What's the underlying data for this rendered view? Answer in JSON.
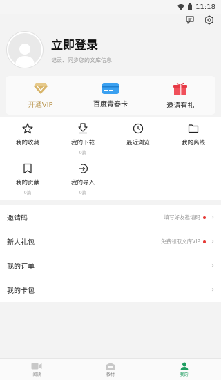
{
  "status_bar": {
    "time": "11:18"
  },
  "profile": {
    "title": "立即登录",
    "subtitle": "记录、同步您的文库信息"
  },
  "cards": [
    {
      "label": "开通VIP",
      "icon": "diamond-icon"
    },
    {
      "label": "百度青春卡",
      "icon": "card-icon"
    },
    {
      "label": "邀请有礼",
      "icon": "gift-icon"
    }
  ],
  "grid": [
    {
      "label": "我的收藏",
      "count": "",
      "icon": "star-icon"
    },
    {
      "label": "我的下载",
      "count": "0篇",
      "icon": "download-icon"
    },
    {
      "label": "最近浏览",
      "count": "",
      "icon": "clock-icon"
    },
    {
      "label": "我的离线",
      "count": "",
      "icon": "folder-icon"
    },
    {
      "label": "我的贡献",
      "count": "0篇",
      "icon": "bookmark-icon"
    },
    {
      "label": "我的导入",
      "count": "0篇",
      "icon": "import-icon"
    }
  ],
  "list": [
    {
      "label": "邀请码",
      "hint": "填写好友邀请码"
    },
    {
      "label": "新人礼包",
      "hint": "免费领取文库VIP"
    },
    {
      "label": "我的订单",
      "hint": ""
    },
    {
      "label": "我的卡包",
      "hint": ""
    }
  ],
  "tabs": [
    {
      "label": "阅读",
      "icon": "video-icon"
    },
    {
      "label": "教材",
      "icon": "textbook-icon"
    },
    {
      "label": "我的",
      "icon": "person-icon"
    }
  ],
  "colors": {
    "accent": "#1f9d60",
    "vip": "#b9954e",
    "red_dot": "#e53935"
  }
}
